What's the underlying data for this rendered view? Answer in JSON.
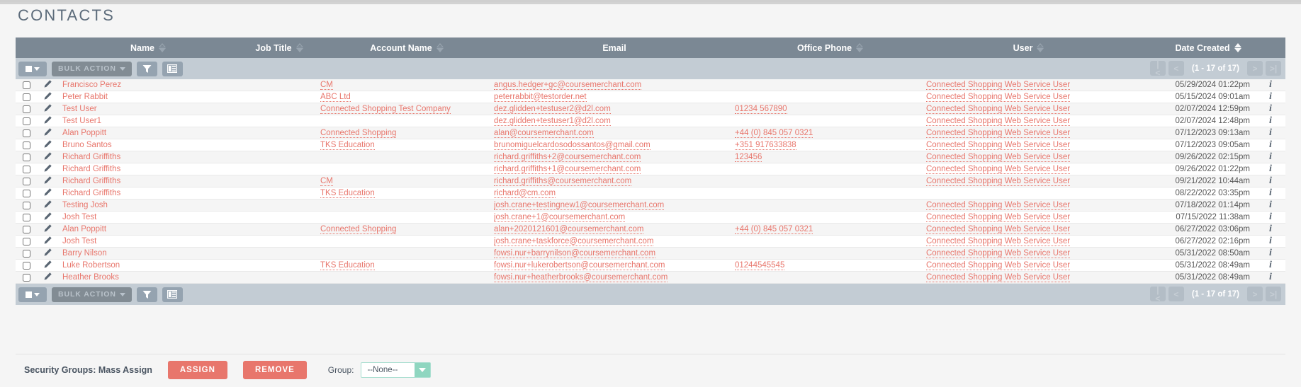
{
  "page": {
    "title": "CONTACTS"
  },
  "columns": [
    {
      "key": "name",
      "label": "Name",
      "sortable": true,
      "active": false
    },
    {
      "key": "job",
      "label": "Job Title",
      "sortable": true,
      "active": false
    },
    {
      "key": "acct",
      "label": "Account Name",
      "sortable": true,
      "active": false
    },
    {
      "key": "email",
      "label": "Email",
      "sortable": false,
      "active": false
    },
    {
      "key": "phone",
      "label": "Office Phone",
      "sortable": true,
      "active": false
    },
    {
      "key": "user",
      "label": "User",
      "sortable": true,
      "active": false
    },
    {
      "key": "date",
      "label": "Date Created",
      "sortable": true,
      "active": true
    }
  ],
  "toolbar": {
    "select_all_icon": "checkbox-dropdown-icon",
    "bulk_action_label": "BULK ACTION",
    "filter_icon": "funnel-icon",
    "columns_icon": "column-chooser-icon"
  },
  "pagination": {
    "first_label": "|<",
    "prev_label": "<",
    "count_label": "(1 - 17 of 17)",
    "next_label": ">",
    "last_label": ">|"
  },
  "rows": [
    {
      "name": "Francisco Perez",
      "job": "",
      "acct": "CM",
      "email": "angus.hedger+gc@coursemerchant.com",
      "phone": "",
      "user": "Connected Shopping Web Service User",
      "date": "05/29/2024 01:22pm"
    },
    {
      "name": "Peter Rabbit",
      "job": "",
      "acct": "ABC Ltd",
      "email": "peterrabbit@testorder.net",
      "phone": "",
      "user": "Connected Shopping Web Service User",
      "date": "05/15/2024 09:01am"
    },
    {
      "name": "Test User",
      "job": "",
      "acct": "Connected Shopping Test Company",
      "email": "dez.glidden+testuser2@d2l.com",
      "phone": "01234 567890",
      "user": "Connected Shopping Web Service User",
      "date": "02/07/2024 12:59pm"
    },
    {
      "name": "Test User1",
      "job": "",
      "acct": "",
      "email": "dez.glidden+testuser1@d2l.com",
      "phone": "",
      "user": "Connected Shopping Web Service User",
      "date": "02/07/2024 12:48pm"
    },
    {
      "name": "Alan Poppitt",
      "job": "",
      "acct": "Connected Shopping",
      "email": "alan@coursemerchant.com",
      "phone": "+44 (0) 845 057 0321",
      "user": "Connected Shopping Web Service User",
      "date": "07/12/2023 09:13am"
    },
    {
      "name": "Bruno Santos",
      "job": "",
      "acct": "TKS Education",
      "email": "brunomiguelcardosodossantos@gmail.com",
      "phone": "+351 917633838",
      "user": "Connected Shopping Web Service User",
      "date": "07/12/2023 09:05am"
    },
    {
      "name": "Richard Griffiths",
      "job": "",
      "acct": "",
      "email": "richard.griffiths+2@coursemerchant.com",
      "phone": "123456",
      "user": "Connected Shopping Web Service User",
      "date": "09/26/2022 02:15pm"
    },
    {
      "name": "Richard Griffiths",
      "job": "",
      "acct": "",
      "email": "richard.griffiths+1@coursemerchant.com",
      "phone": "",
      "user": "Connected Shopping Web Service User",
      "date": "09/26/2022 01:22pm"
    },
    {
      "name": "Richard Griffiths",
      "job": "",
      "acct": "CM",
      "email": "richard.griffiths@coursemerchant.com",
      "phone": "",
      "user": "Connected Shopping Web Service User",
      "date": "09/21/2022 10:44am"
    },
    {
      "name": "Richard Griffiths",
      "job": "",
      "acct": "TKS Education",
      "email": "richard@cm.com",
      "phone": "",
      "user": "",
      "date": "08/22/2022 03:35pm"
    },
    {
      "name": "Testing Josh",
      "job": "",
      "acct": "",
      "email": "josh.crane+testingnew1@coursemerchant.com",
      "phone": "",
      "user": "Connected Shopping Web Service User",
      "date": "07/18/2022 01:14pm"
    },
    {
      "name": "Josh Test",
      "job": "",
      "acct": "",
      "email": "josh.crane+1@coursemerchant.com",
      "phone": "",
      "user": "Connected Shopping Web Service User",
      "date": "07/15/2022 11:38am"
    },
    {
      "name": "Alan Poppitt",
      "job": "",
      "acct": "Connected Shopping",
      "email": "alan+2020121601@coursemerchant.com",
      "phone": "+44 (0) 845 057 0321",
      "user": "Connected Shopping Web Service User",
      "date": "06/27/2022 03:06pm"
    },
    {
      "name": "Josh Test",
      "job": "",
      "acct": "",
      "email": "josh.crane+taskforce@coursemerchant.com",
      "phone": "",
      "user": "Connected Shopping Web Service User",
      "date": "06/27/2022 02:16pm"
    },
    {
      "name": "Barry Nilson",
      "job": "",
      "acct": "",
      "email": "fowsi.nur+barrynilson@coursemerchant.com",
      "phone": "",
      "user": "Connected Shopping Web Service User",
      "date": "05/31/2022 08:50am"
    },
    {
      "name": "Luke Robertson",
      "job": "",
      "acct": "TKS Education",
      "email": "fowsi.nur+lukerobertson@coursemerchant.com",
      "phone": "01244545545",
      "user": "Connected Shopping Web Service User",
      "date": "05/31/2022 08:49am"
    },
    {
      "name": "Heather Brooks",
      "job": "",
      "acct": "",
      "email": "fowsi.nur+heatherbrooks@coursemerchant.com",
      "phone": "",
      "user": "Connected Shopping Web Service User",
      "date": "05/31/2022 08:49am"
    }
  ],
  "mass_assign": {
    "label": "Security Groups: Mass Assign",
    "assign_label": "ASSIGN",
    "remove_label": "REMOVE",
    "group_label": "Group:",
    "group_value": "--None--",
    "group_options": [
      "--None--"
    ]
  },
  "colors": {
    "link": "#e8766c",
    "header_band": "#7b8894",
    "toolbar_band": "#c3ccd4",
    "button_red": "#e8766c",
    "select_accent": "#8fd6c0",
    "title": "#5d6c7b"
  }
}
